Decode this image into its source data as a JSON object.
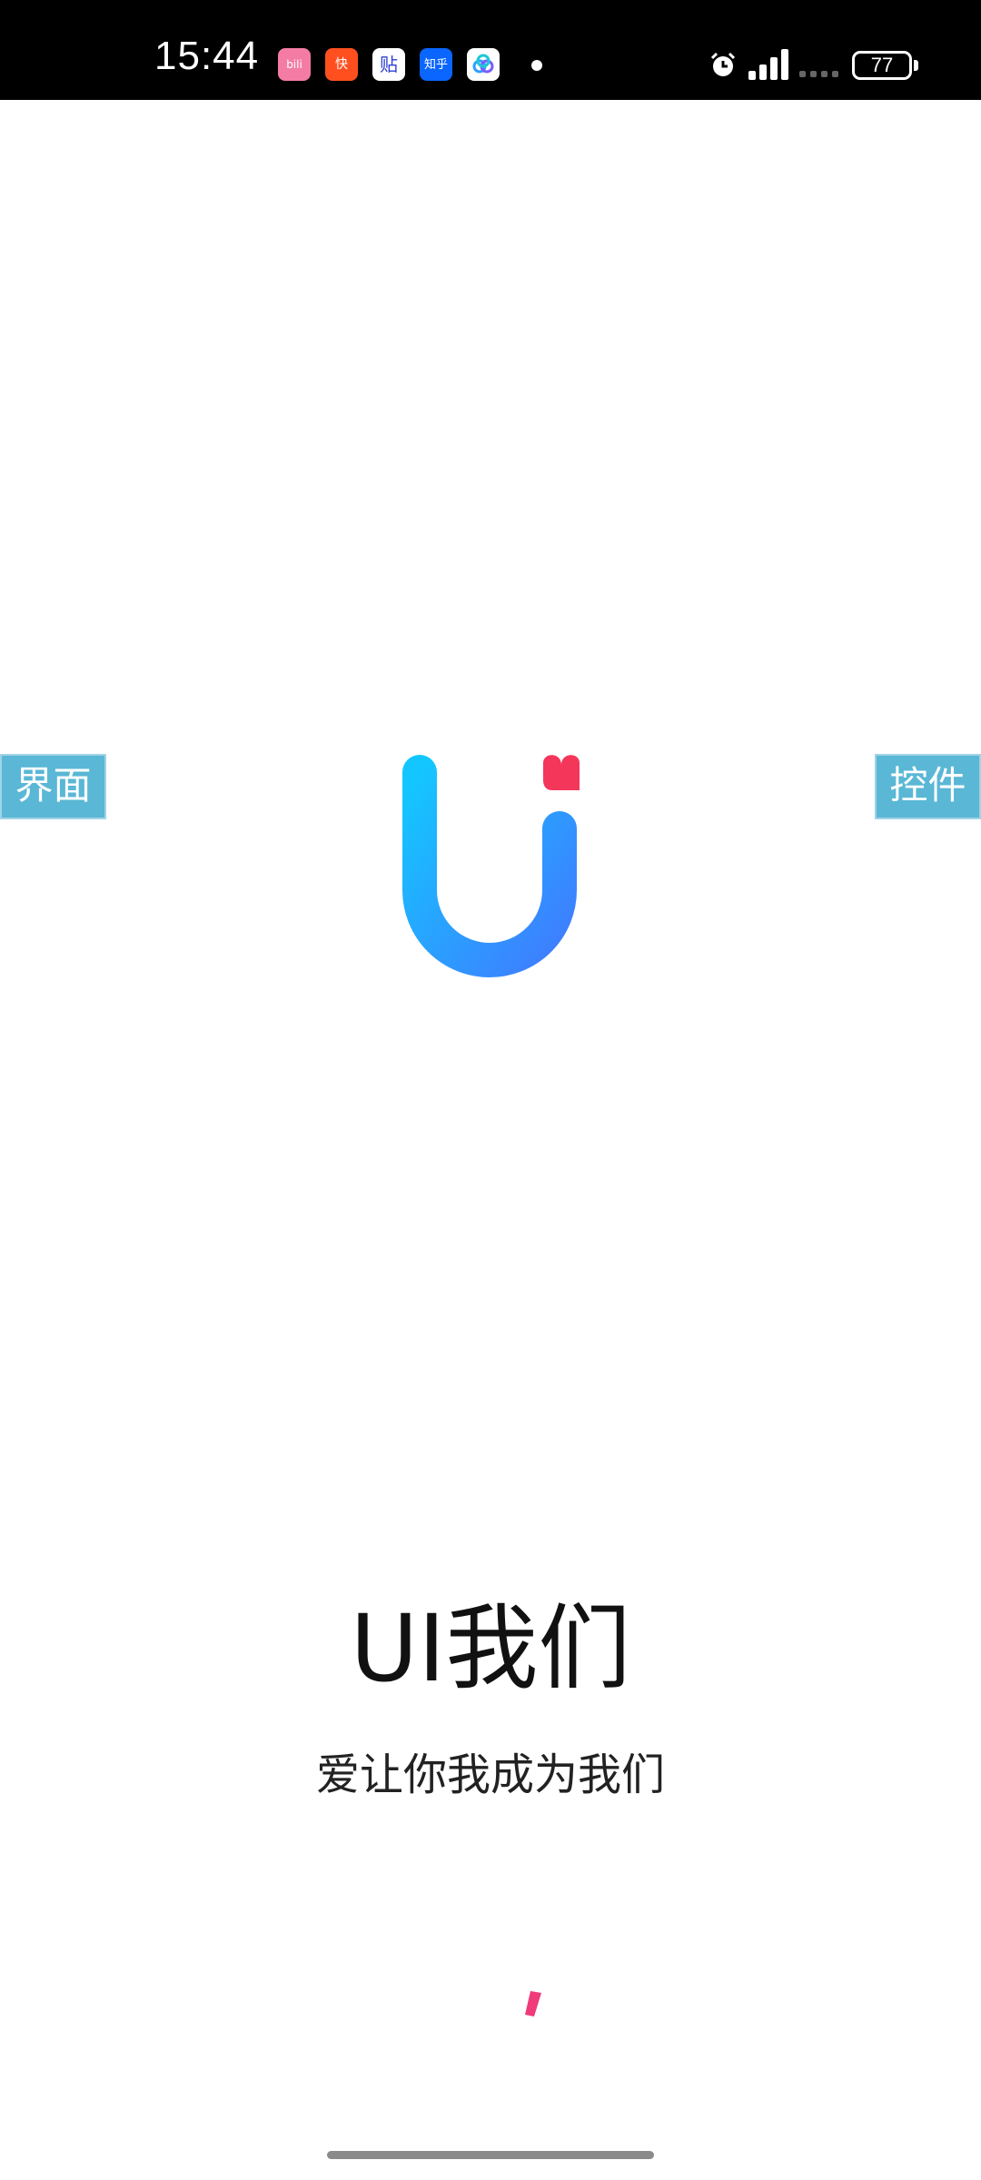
{
  "status_bar": {
    "time": "15:44",
    "notifications": [
      {
        "name": "bilibili-icon",
        "label": "bili",
        "color": "#f47ca4"
      },
      {
        "name": "kuaishou-icon",
        "label": "快",
        "color": "#ff4f1f"
      },
      {
        "name": "tieba-icon",
        "label": "贴",
        "color": "#ffffff"
      },
      {
        "name": "zhihu-icon",
        "label": "知乎",
        "color": "#0a66ff"
      },
      {
        "name": "cloud-icon",
        "label": "云",
        "color": "#ffffff"
      }
    ],
    "battery": "77"
  },
  "side_tabs": {
    "left": "界面",
    "right": "控件"
  },
  "app": {
    "title": "UI我们",
    "slogan": "爱让你我成为我们"
  },
  "colors": {
    "logo_start": "#14c6ff",
    "logo_end": "#3f7cff",
    "heart": "#f4365b",
    "tab_bg": "#5ab7d6",
    "spinner": "#f03a7a"
  }
}
